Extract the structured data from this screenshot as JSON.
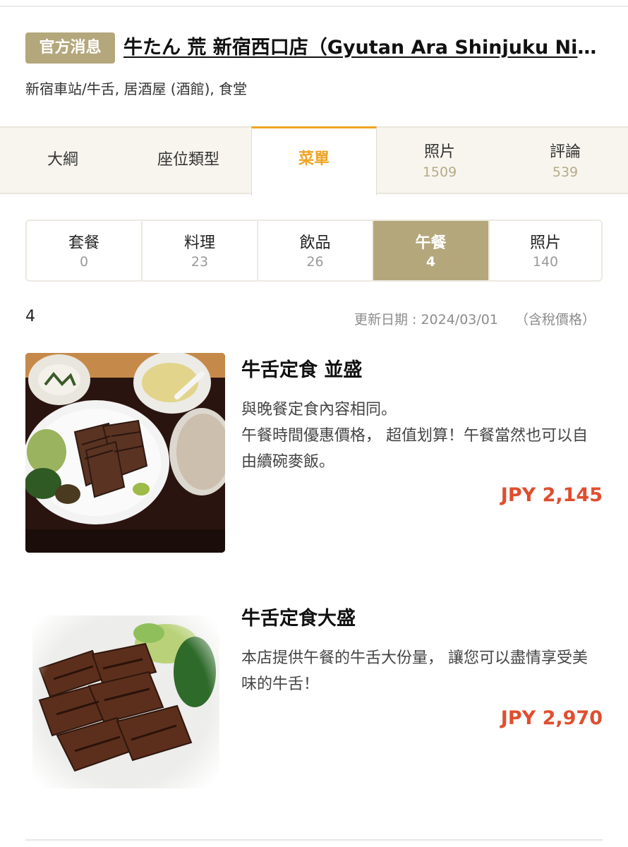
{
  "header": {
    "badge": "官方消息",
    "title": "牛たん 荒 新宿西口店（Gyutan Ara Shinjuku Nishiguchi）",
    "subtitle": "新宿車站/牛舌, 居酒屋 (酒館), 食堂"
  },
  "main_tabs": [
    {
      "label": "大綱",
      "count": null
    },
    {
      "label": "座位類型",
      "count": null
    },
    {
      "label": "菜單",
      "count": null,
      "active": true
    },
    {
      "label": "照片",
      "count": "1509"
    },
    {
      "label": "評論",
      "count": "539"
    }
  ],
  "sub_tabs": [
    {
      "label": "套餐",
      "count": "0"
    },
    {
      "label": "料理",
      "count": "23"
    },
    {
      "label": "飲品",
      "count": "26"
    },
    {
      "label": "午餐",
      "count": "4",
      "active": true
    },
    {
      "label": "照片",
      "count": "140"
    }
  ],
  "list_info": {
    "count": "4",
    "updated": "更新日期 : 2024/03/01",
    "tax_note": "（含稅價格）"
  },
  "items": [
    {
      "name": "牛舌定食 並盛",
      "desc_lines": [
        "與晚餐定食內容相同。",
        "午餐時間優惠價格， 超值划算！午餐當然也可以自由續碗麥飯。"
      ],
      "price": "JPY 2,145",
      "image_icon": "beef-tongue-set-meal-photo"
    },
    {
      "name": "牛舌定食大盛",
      "desc_lines": [
        "本店提供午餐的牛舌大份量， 讓您可以盡情享受美味的牛舌！"
      ],
      "price": "JPY 2,970",
      "image_icon": "grilled-beef-tongue-photo"
    }
  ],
  "colors": {
    "badge": "#b4a77c",
    "active_tab": "#f0a322",
    "price": "#e04e2e"
  }
}
